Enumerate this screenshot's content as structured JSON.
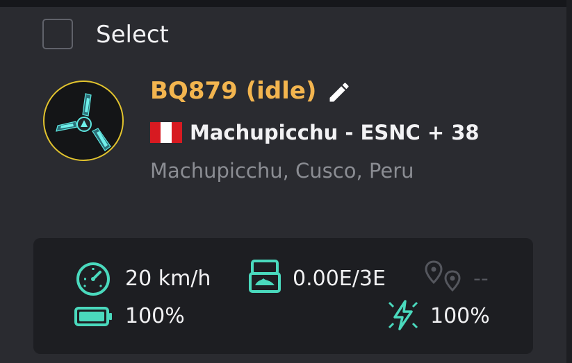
{
  "select": {
    "label": "Select",
    "checked": false
  },
  "robot": {
    "title": "BQ879 (idle)",
    "title_color": "#f3b54f",
    "location_name": "Machupicchu - ESNC + 38",
    "country_flag": "peru-flag",
    "address": "Machupicchu, Cusco, Peru",
    "avatar_icon": "drone-robot-avatar",
    "edit_icon": "pencil-icon"
  },
  "stats": {
    "speed": "20 km/h",
    "storage": "0.00E/3E",
    "gps": "--",
    "battery": "100%",
    "charge": "100%",
    "accent_color": "#4ad9bd"
  }
}
